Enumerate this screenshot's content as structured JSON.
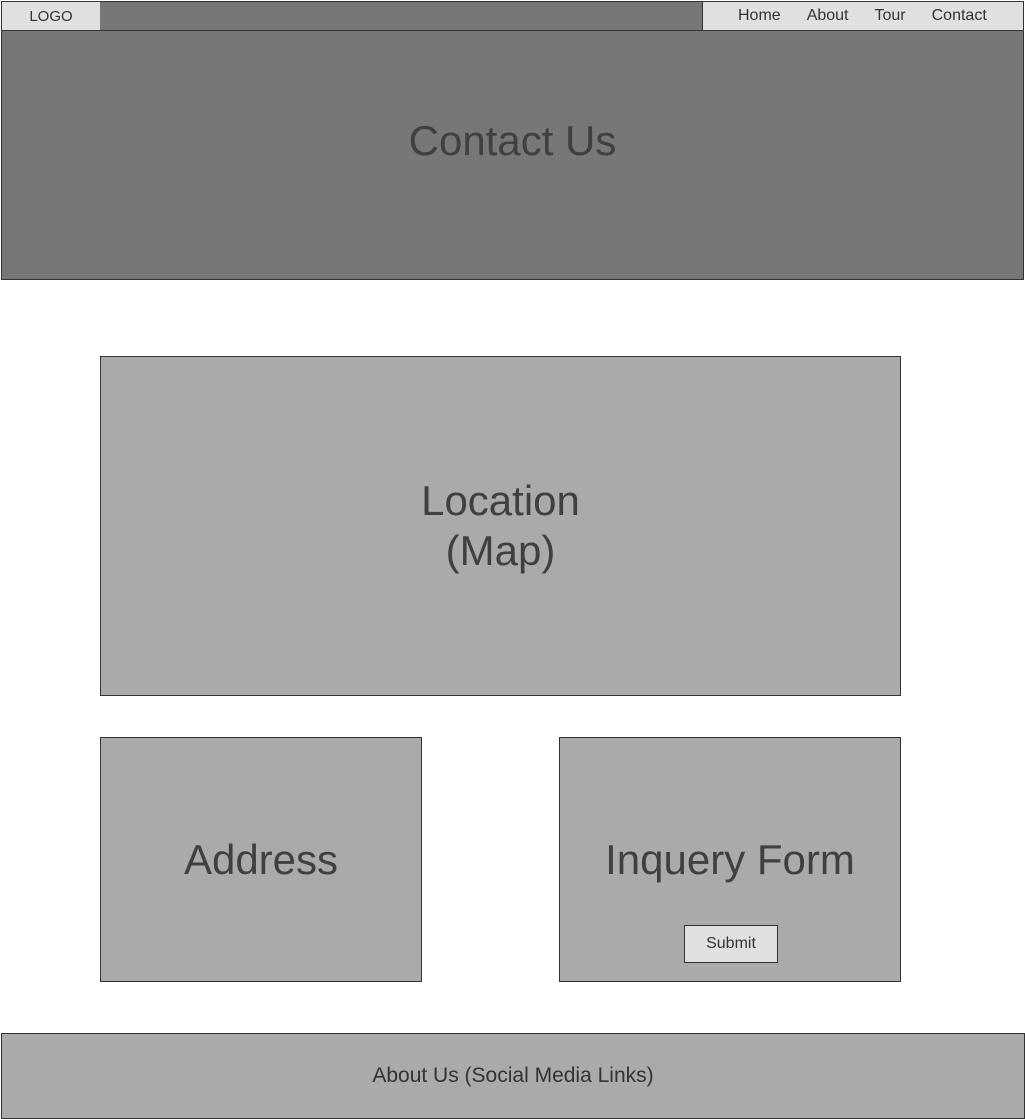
{
  "header": {
    "logo": "LOGO",
    "nav": [
      "Home",
      "About",
      "Tour",
      "Contact"
    ]
  },
  "hero": {
    "title": "Contact Us"
  },
  "map": {
    "line1": "Location",
    "line2": "(Map)"
  },
  "address": {
    "title": "Address"
  },
  "inquiry": {
    "title": "Inquery Form",
    "submit_label": "Submit"
  },
  "footer": {
    "text": "About Us (Social Media Links)"
  },
  "colors": {
    "topbar": "#777777",
    "panel": "#aaaaaa",
    "light": "#e0e0e0",
    "border": "#333333"
  }
}
